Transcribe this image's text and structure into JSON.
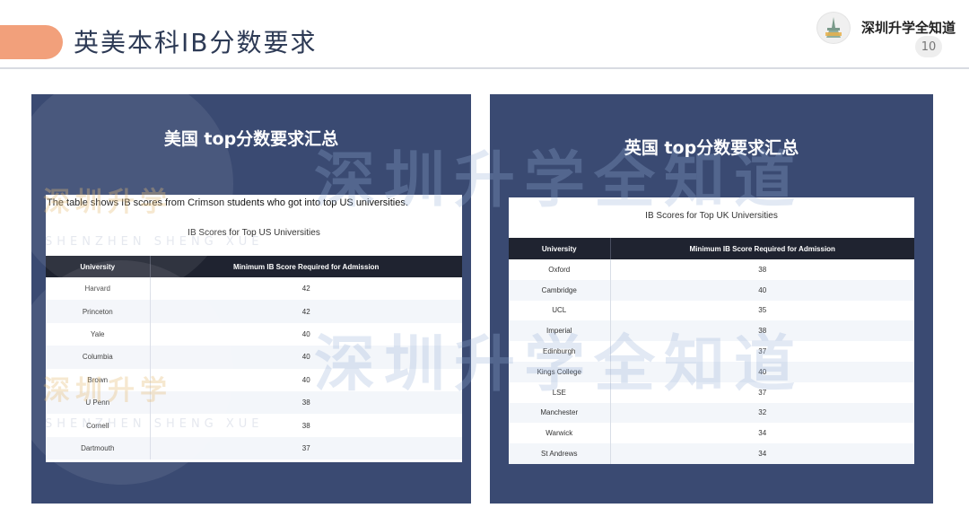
{
  "header": {
    "title": "英美本科IB分数要求",
    "brand_name": "深圳升学全知道",
    "page_number": "10"
  },
  "colors": {
    "accent": "#f2a07b",
    "panel": "#3a4a72",
    "table_header": "#1f2330"
  },
  "watermark": {
    "main_text": "深圳升学全知道",
    "stamp_text": "深圳升学",
    "stamp_subtext": "SHENZHEN SHENG XUE"
  },
  "us_panel": {
    "heading": "美国 top分数要求汇总",
    "note": "The table shows IB scores from Crimson students who got into top US universities.",
    "caption": "IB Scores for Top US Universities",
    "columns": [
      "University",
      "Minimum IB Score Required for Admission"
    ],
    "rows": [
      [
        "Harvard",
        "42"
      ],
      [
        "Princeton",
        "42"
      ],
      [
        "Yale",
        "40"
      ],
      [
        "Columbia",
        "40"
      ],
      [
        "Brown",
        "40"
      ],
      [
        "U Penn",
        "38"
      ],
      [
        "Cornell",
        "38"
      ],
      [
        "Dartmouth",
        "37"
      ]
    ]
  },
  "uk_panel": {
    "heading": "英国 top分数要求汇总",
    "caption": "IB Scores for Top UK Universities",
    "columns": [
      "University",
      "Minimum IB Score Required for Admission"
    ],
    "rows": [
      [
        "Oxford",
        "38"
      ],
      [
        "Cambridge",
        "40"
      ],
      [
        "UCL",
        "35"
      ],
      [
        "Imperial",
        "38"
      ],
      [
        "Edinburgh",
        "37"
      ],
      [
        "Kings College",
        "40"
      ],
      [
        "LSE",
        "37"
      ],
      [
        "Manchester",
        "32"
      ],
      [
        "Warwick",
        "34"
      ],
      [
        "St Andrews",
        "34"
      ]
    ]
  }
}
